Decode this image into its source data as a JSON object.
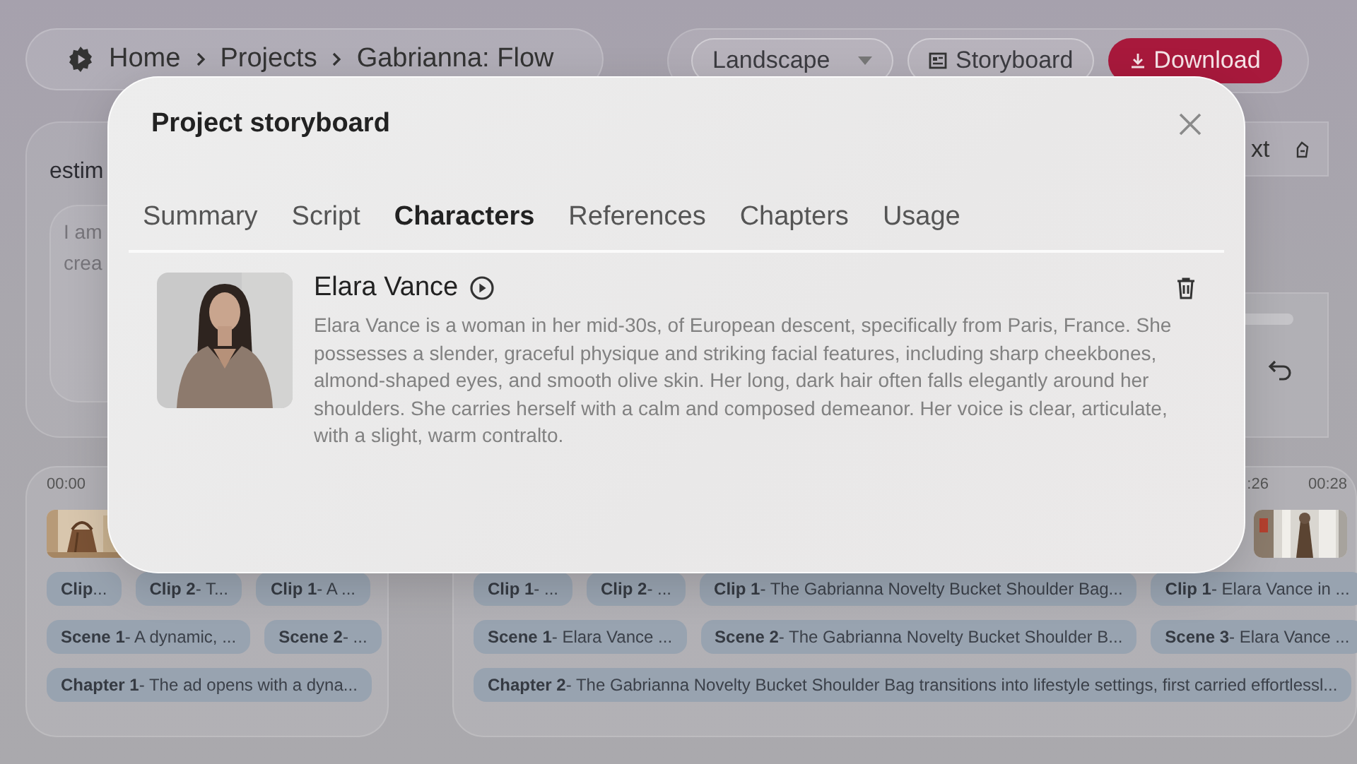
{
  "breadcrumb": [
    {
      "label": "Home"
    },
    {
      "label": "Projects"
    },
    {
      "label": "Gabrianna: Flow"
    }
  ],
  "toolbar": {
    "format_select": {
      "value": "Landscape"
    },
    "storyboard_button": {
      "label": "Storyboard"
    },
    "download_button": {
      "label": "Download"
    }
  },
  "prompt_panel": {
    "text_fragment": "estim",
    "input_lines": [
      "I am",
      "crea"
    ]
  },
  "side_button": {
    "label": "xt"
  },
  "timelines": [
    {
      "times": [
        "00:00"
      ],
      "clips": [
        "**Clip**...",
        "**Clip 2**- T...",
        "**Clip 1**- A ..."
      ],
      "scenes": [
        "**Scene 1**- A dynamic, ...",
        "**Scene 2**- ..."
      ],
      "chapters": [
        "**Chapter 1**- The ad opens with a dyna..."
      ]
    },
    {
      "times": [
        ":26",
        "00:28"
      ],
      "clips": [
        "**Clip 1**- ...",
        "**Clip 2**- ...",
        "**Clip 1**- The Gabrianna Novelty Bucket Shoulder Bag...",
        "**Clip 1**- Elara Vance in ..."
      ],
      "scenes": [
        "**Scene 1**- Elara Vance ...",
        "**Scene 2**- The Gabrianna Novelty Bucket Shoulder B...",
        "**Scene 3**- Elara Vance ..."
      ],
      "chapters": [
        "**Chapter 2**- The Gabrianna Novelty Bucket Shoulder Bag transitions into lifestyle settings, first carried effortlessl..."
      ]
    }
  ],
  "modal": {
    "title": "Project storyboard",
    "tabs": [
      {
        "label": "Summary",
        "selected": false
      },
      {
        "label": "Script",
        "selected": false
      },
      {
        "label": "Characters",
        "selected": true
      },
      {
        "label": "References",
        "selected": false
      },
      {
        "label": "Chapters",
        "selected": false
      },
      {
        "label": "Usage",
        "selected": false
      }
    ],
    "characters": [
      {
        "name": "Elara Vance",
        "description": "Elara Vance is a woman in her mid-30s, of European descent, specifically from Paris, France. She possesses a slender, graceful physique and striking facial features, including sharp cheekbones, almond-shaped eyes, and smooth olive skin. Her long, dark hair often falls elegantly around her shoulders. She carries herself with a calm and composed demeanor. Her voice is clear, articulate, with a slight, warm contralto."
      }
    ]
  }
}
